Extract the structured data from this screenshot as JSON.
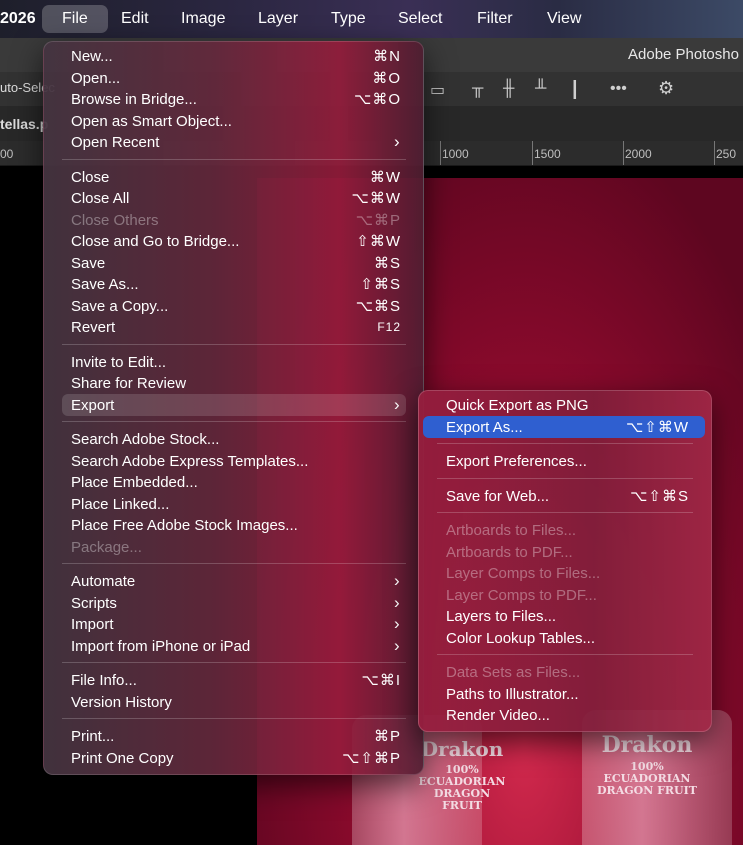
{
  "menubar": {
    "app_fragment": "2026",
    "items": [
      "File",
      "Edit",
      "Image",
      "Layer",
      "Type",
      "Select",
      "Filter",
      "View"
    ]
  },
  "app": {
    "title_fragment": "Adobe Photosho",
    "auto_select": "uto-Selec",
    "doc_tab": "tellas.p"
  },
  "ruler": {
    "ticks": [
      "00",
      "1000",
      "1500",
      "2000",
      "250"
    ]
  },
  "icons": {
    "more": "•••",
    "gear": "⚙"
  },
  "file_menu": {
    "groups": [
      [
        {
          "label": "New...",
          "shortcut": "⌘N"
        },
        {
          "label": "Open...",
          "shortcut": "⌘O"
        },
        {
          "label": "Browse in Bridge...",
          "shortcut": "⌥⌘O"
        },
        {
          "label": "Open as Smart Object..."
        },
        {
          "label": "Open Recent",
          "submenu": true
        }
      ],
      [
        {
          "label": "Close",
          "shortcut": "⌘W"
        },
        {
          "label": "Close All",
          "shortcut": "⌥⌘W"
        },
        {
          "label": "Close Others",
          "shortcut": "⌥⌘P",
          "disabled": true
        },
        {
          "label": "Close and Go to Bridge...",
          "shortcut": "⇧⌘W"
        },
        {
          "label": "Save",
          "shortcut": "⌘S"
        },
        {
          "label": "Save As...",
          "shortcut": "⇧⌘S"
        },
        {
          "label": "Save a Copy...",
          "shortcut": "⌥⌘S"
        },
        {
          "label": "Revert",
          "shortcut": "F12"
        }
      ],
      [
        {
          "label": "Invite to Edit..."
        },
        {
          "label": "Share for Review"
        },
        {
          "label": "Export",
          "submenu": true,
          "highlighted": true
        }
      ],
      [
        {
          "label": "Search Adobe Stock..."
        },
        {
          "label": "Search Adobe Express Templates..."
        },
        {
          "label": "Place Embedded..."
        },
        {
          "label": "Place Linked..."
        },
        {
          "label": "Place Free Adobe Stock Images..."
        },
        {
          "label": "Package...",
          "disabled": true
        }
      ],
      [
        {
          "label": "Automate",
          "submenu": true
        },
        {
          "label": "Scripts",
          "submenu": true
        },
        {
          "label": "Import",
          "submenu": true
        },
        {
          "label": "Import from iPhone or iPad",
          "submenu": true
        }
      ],
      [
        {
          "label": "File Info...",
          "shortcut": "⌥⌘I"
        },
        {
          "label": "Version History"
        }
      ],
      [
        {
          "label": "Print...",
          "shortcut": "⌘P"
        },
        {
          "label": "Print One Copy",
          "shortcut": "⌥⇧⌘P"
        }
      ]
    ]
  },
  "export_menu": {
    "groups": [
      [
        {
          "label": "Quick Export as PNG"
        },
        {
          "label": "Export As...",
          "shortcut": "⌥⇧⌘W",
          "selected": true
        }
      ],
      [
        {
          "label": "Export Preferences..."
        }
      ],
      [
        {
          "label": "Save for Web...",
          "shortcut": "⌥⇧⌘S"
        }
      ],
      [
        {
          "label": "Artboards to Files...",
          "disabled": true
        },
        {
          "label": "Artboards to PDF...",
          "disabled": true
        },
        {
          "label": "Layer Comps to Files...",
          "disabled": true
        },
        {
          "label": "Layer Comps to PDF...",
          "disabled": true
        },
        {
          "label": "Layers to Files..."
        },
        {
          "label": "Color Lookup Tables..."
        }
      ],
      [
        {
          "label": "Data Sets as Files...",
          "disabled": true
        },
        {
          "label": "Paths to Illustrator..."
        },
        {
          "label": "Render Video..."
        }
      ]
    ]
  },
  "artwork": {
    "label_1": "Drakon",
    "label_1_sub": "100% ECUADORIAN DRAGON FRUIT",
    "label_2": "Drakon",
    "label_2_sub": "100% ECUADORIAN DRAGON FRUIT"
  },
  "colors": {
    "selection": "#2f5fd0",
    "export_highlight": "rgba(255,255,255,0.14)"
  }
}
